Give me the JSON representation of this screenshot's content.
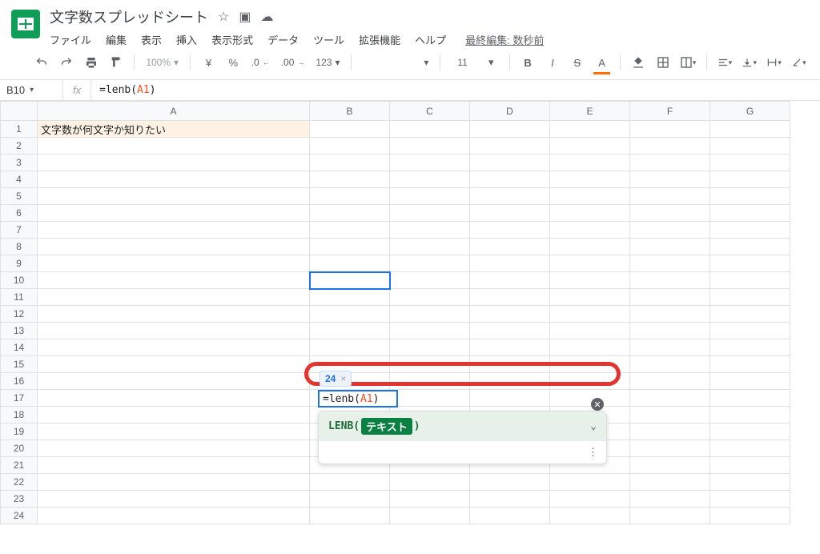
{
  "header": {
    "title": "文字数スプレッドシート",
    "last_edit": "最終編集: 数秒前"
  },
  "menus": {
    "file": "ファイル",
    "edit": "編集",
    "view": "表示",
    "insert": "挿入",
    "format": "表示形式",
    "data": "データ",
    "tools": "ツール",
    "extensions": "拡張機能",
    "help": "ヘルプ"
  },
  "toolbar": {
    "zoom": "100%",
    "currency": "¥",
    "percent": "%",
    "dec_dec": ".0",
    "inc_dec": ".00",
    "numfmt": "123",
    "font_size": "11"
  },
  "namebox": {
    "ref": "B10"
  },
  "formula_bar": {
    "prefix": "=lenb(",
    "ref": "A1",
    "suffix": ")"
  },
  "columns": [
    "A",
    "B",
    "C",
    "D",
    "E",
    "F",
    "G"
  ],
  "row_count": 24,
  "cells": {
    "A1": "文字数が何文字か知りたい"
  },
  "popup": {
    "result": "24",
    "edit_prefix": "=lenb(",
    "edit_ref": "A1",
    "edit_suffix": ")",
    "func": "LENB(",
    "param": "テキスト",
    "func_close": ")"
  }
}
